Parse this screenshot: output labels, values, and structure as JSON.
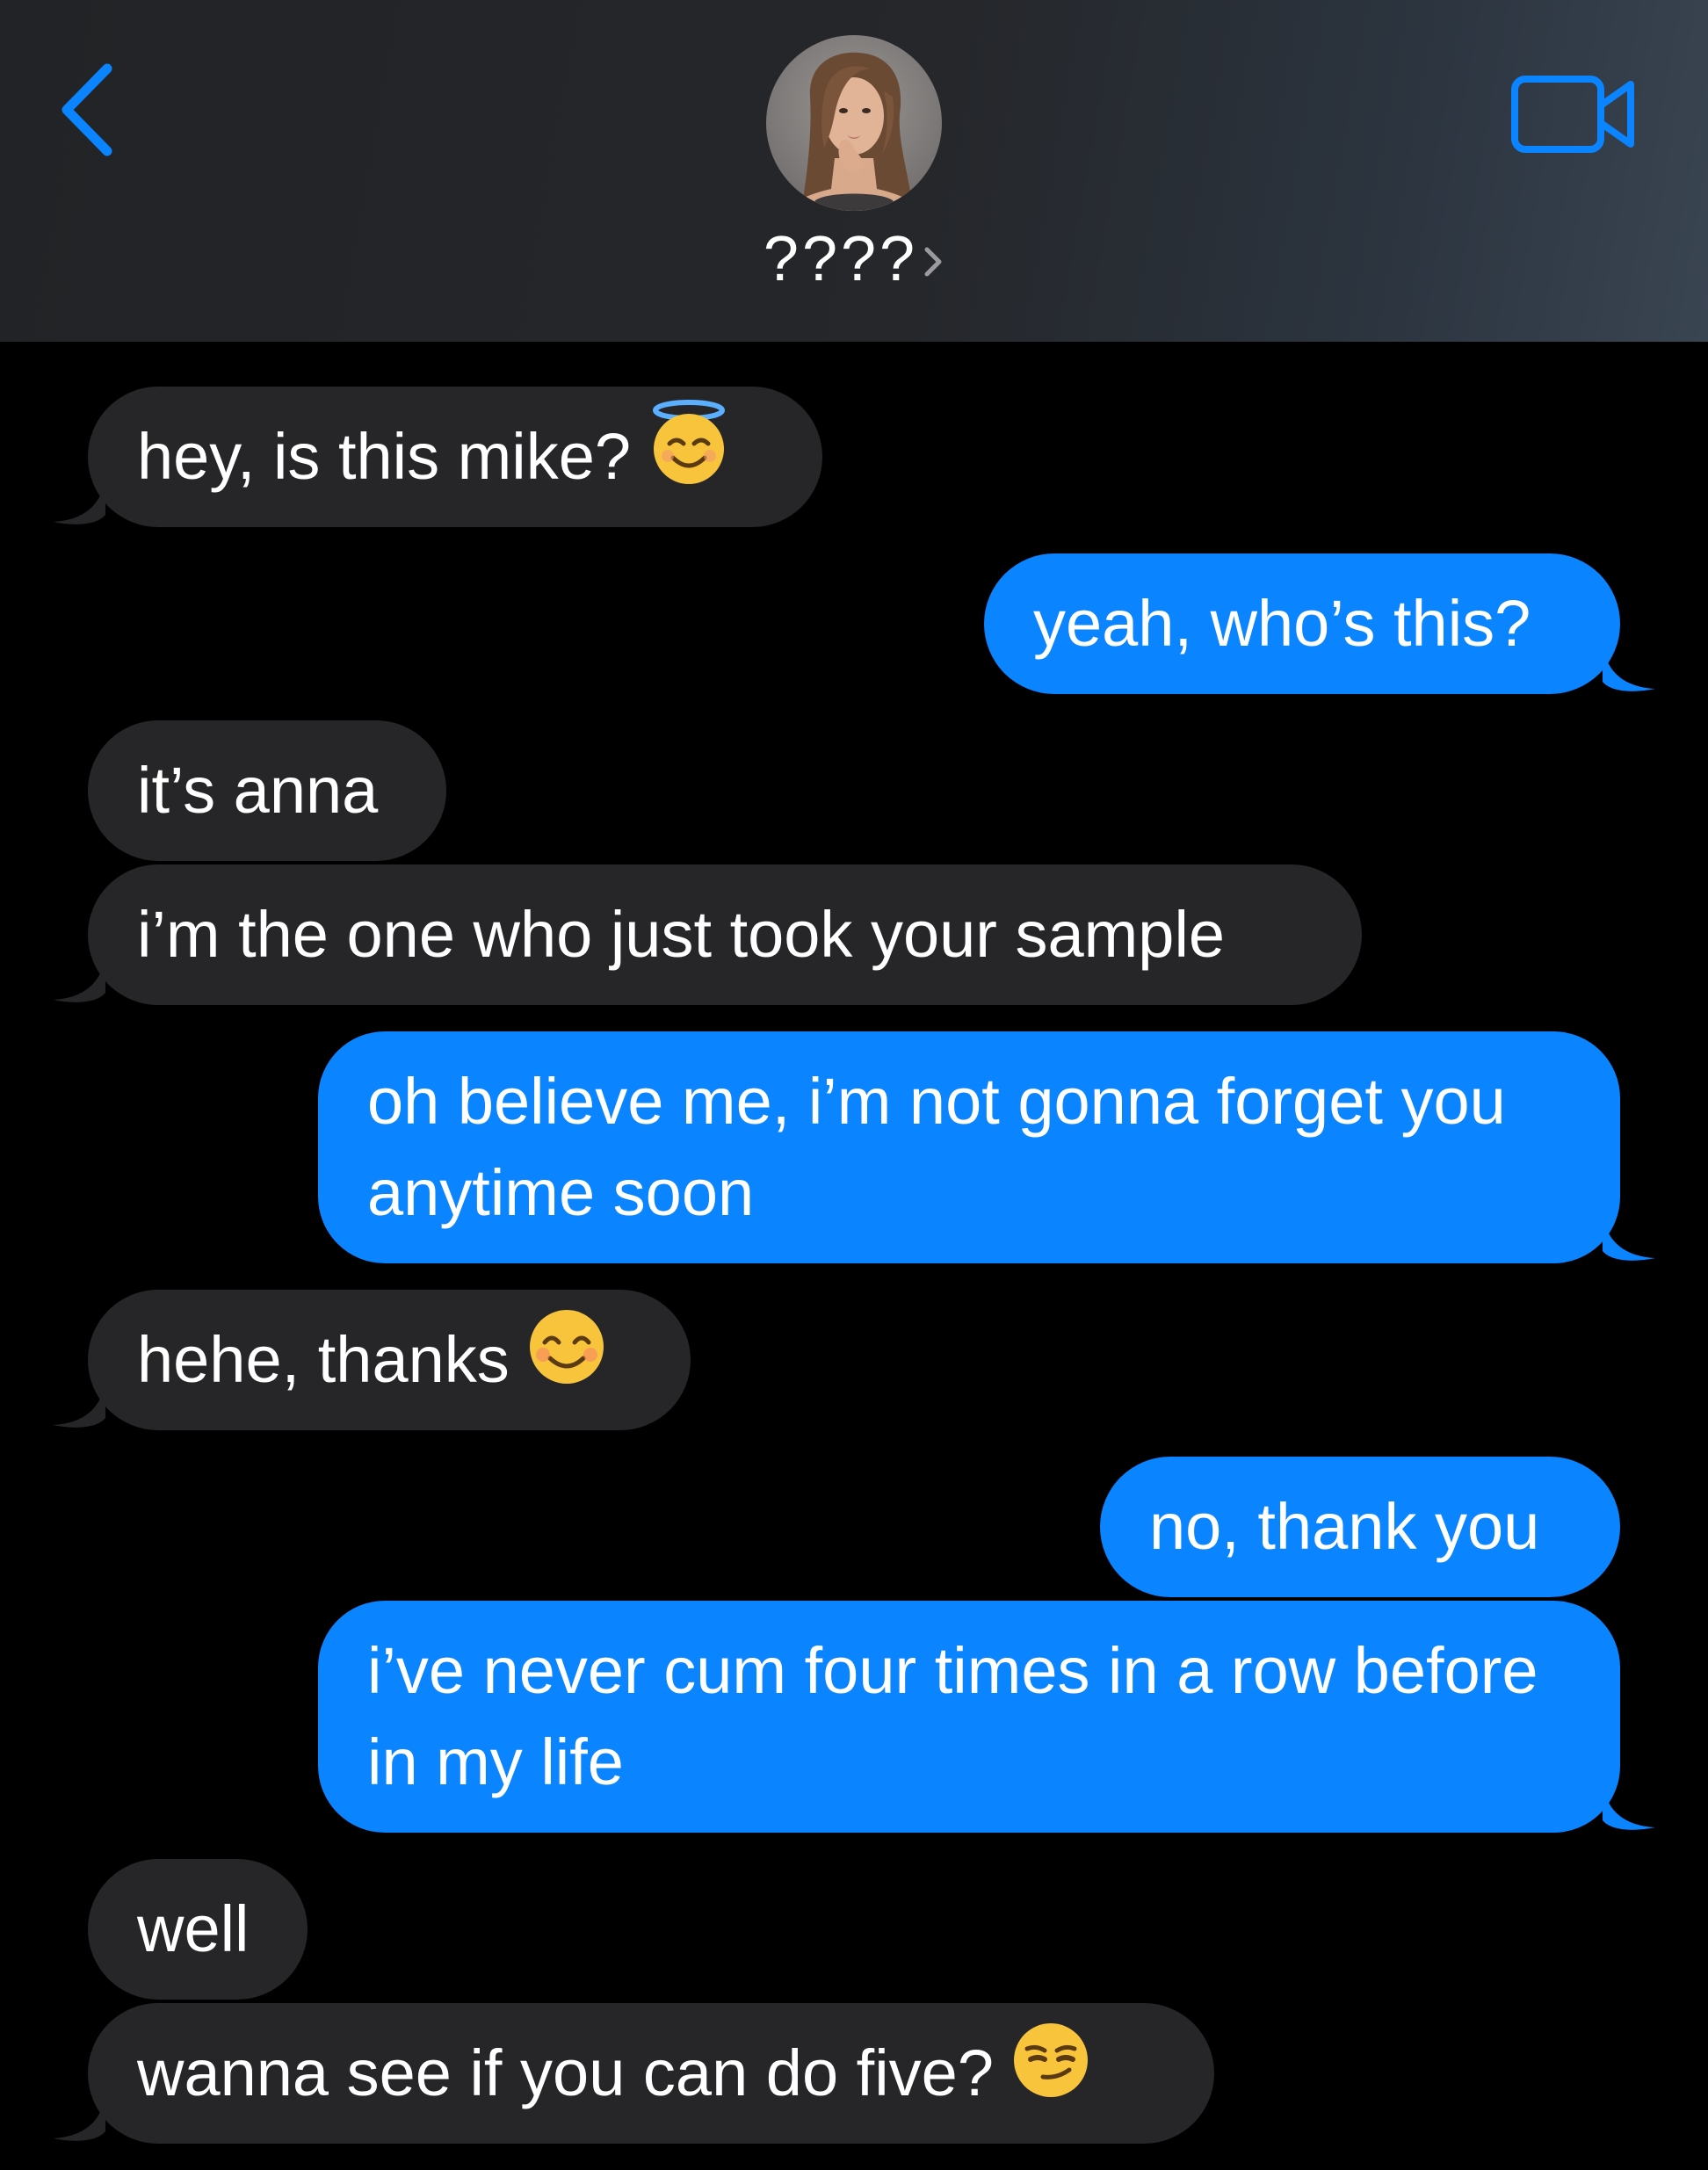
{
  "header": {
    "back_label": "‹",
    "contact_name": "????",
    "avatar_alt": "contact-photo",
    "video_icon": "video-camera-icon"
  },
  "colors": {
    "background": "#000000",
    "header_bg": "#232427",
    "received_bubble": "#262629",
    "sent_bubble": "#0a84ff",
    "accent": "#0a84ff",
    "text": "#ffffff"
  },
  "messages": [
    {
      "from": "them",
      "text": "hey, is this mike?",
      "emoji": "smiling-face-with-halo"
    },
    {
      "from": "me",
      "text": "yeah, who’s this?"
    },
    {
      "from": "them",
      "text": "it’s anna"
    },
    {
      "from": "them",
      "text": "i’m the one who just took your sample"
    },
    {
      "from": "me",
      "text": "oh believe me, i’m not gonna forget you anytime soon"
    },
    {
      "from": "them",
      "text": "hehe, thanks",
      "emoji": "smiling-face-with-smiling-eyes"
    },
    {
      "from": "me",
      "text": "no, thank you"
    },
    {
      "from": "me",
      "text": "i’ve never cum four times in a row before in my life"
    },
    {
      "from": "them",
      "text": "well"
    },
    {
      "from": "them",
      "text": "wanna see if you can do five?",
      "emoji": "smirking-face"
    }
  ]
}
